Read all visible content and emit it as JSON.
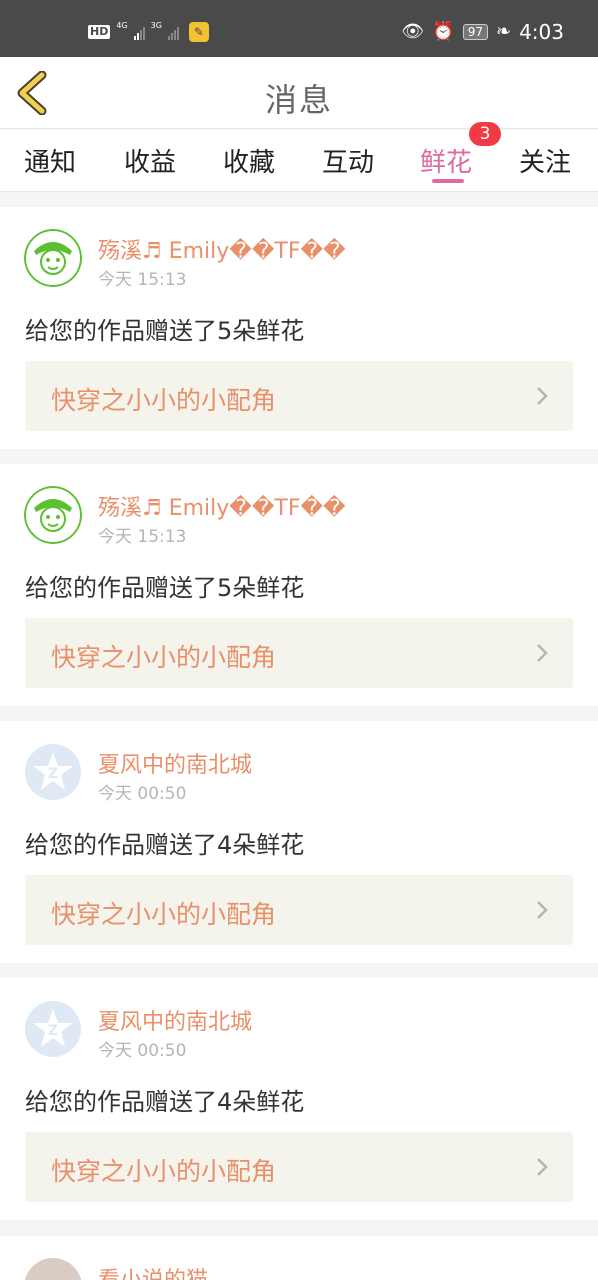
{
  "status_bar": {
    "hd": "HD",
    "sim1_net": "4G",
    "sim2_net": "3G",
    "battery": "97",
    "time": "4:03",
    "icons": [
      "eye-icon",
      "alarm-icon",
      "battery-icon",
      "leaf-icon"
    ]
  },
  "header": {
    "title": "消息",
    "back_icon": "chevron-left-icon"
  },
  "tabs": [
    {
      "label": "通知"
    },
    {
      "label": "收益"
    },
    {
      "label": "收藏"
    },
    {
      "label": "互动"
    },
    {
      "label": "鲜花",
      "active": true,
      "badge": "3"
    },
    {
      "label": "关注"
    }
  ],
  "messages": [
    {
      "user": "殇溪♬ Emily��TF��",
      "time": "今天 15:13",
      "text": "给您的作品赠送了5朵鲜花",
      "work": "快穿之小小的小配角",
      "avatar": "cartoon-avatar"
    },
    {
      "user": "殇溪♬ Emily��TF��",
      "time": "今天 15:13",
      "text": "给您的作品赠送了5朵鲜花",
      "work": "快穿之小小的小配角",
      "avatar": "cartoon-avatar"
    },
    {
      "user": "夏风中的南北城",
      "time": "今天 00:50",
      "text": "给您的作品赠送了4朵鲜花",
      "work": "快穿之小小的小配角",
      "avatar": "default-star-avatar"
    },
    {
      "user": "夏风中的南北城",
      "time": "今天 00:50",
      "text": "给您的作品赠送了4朵鲜花",
      "work": "快穿之小小的小配角",
      "avatar": "default-star-avatar"
    }
  ],
  "partial_message": {
    "user": "看小说的猫"
  },
  "colors": {
    "accent_pink": "#e06aa0",
    "name_orange": "#e8906a",
    "badge_red": "#f03a45",
    "link_bg": "#f4f3ec"
  }
}
